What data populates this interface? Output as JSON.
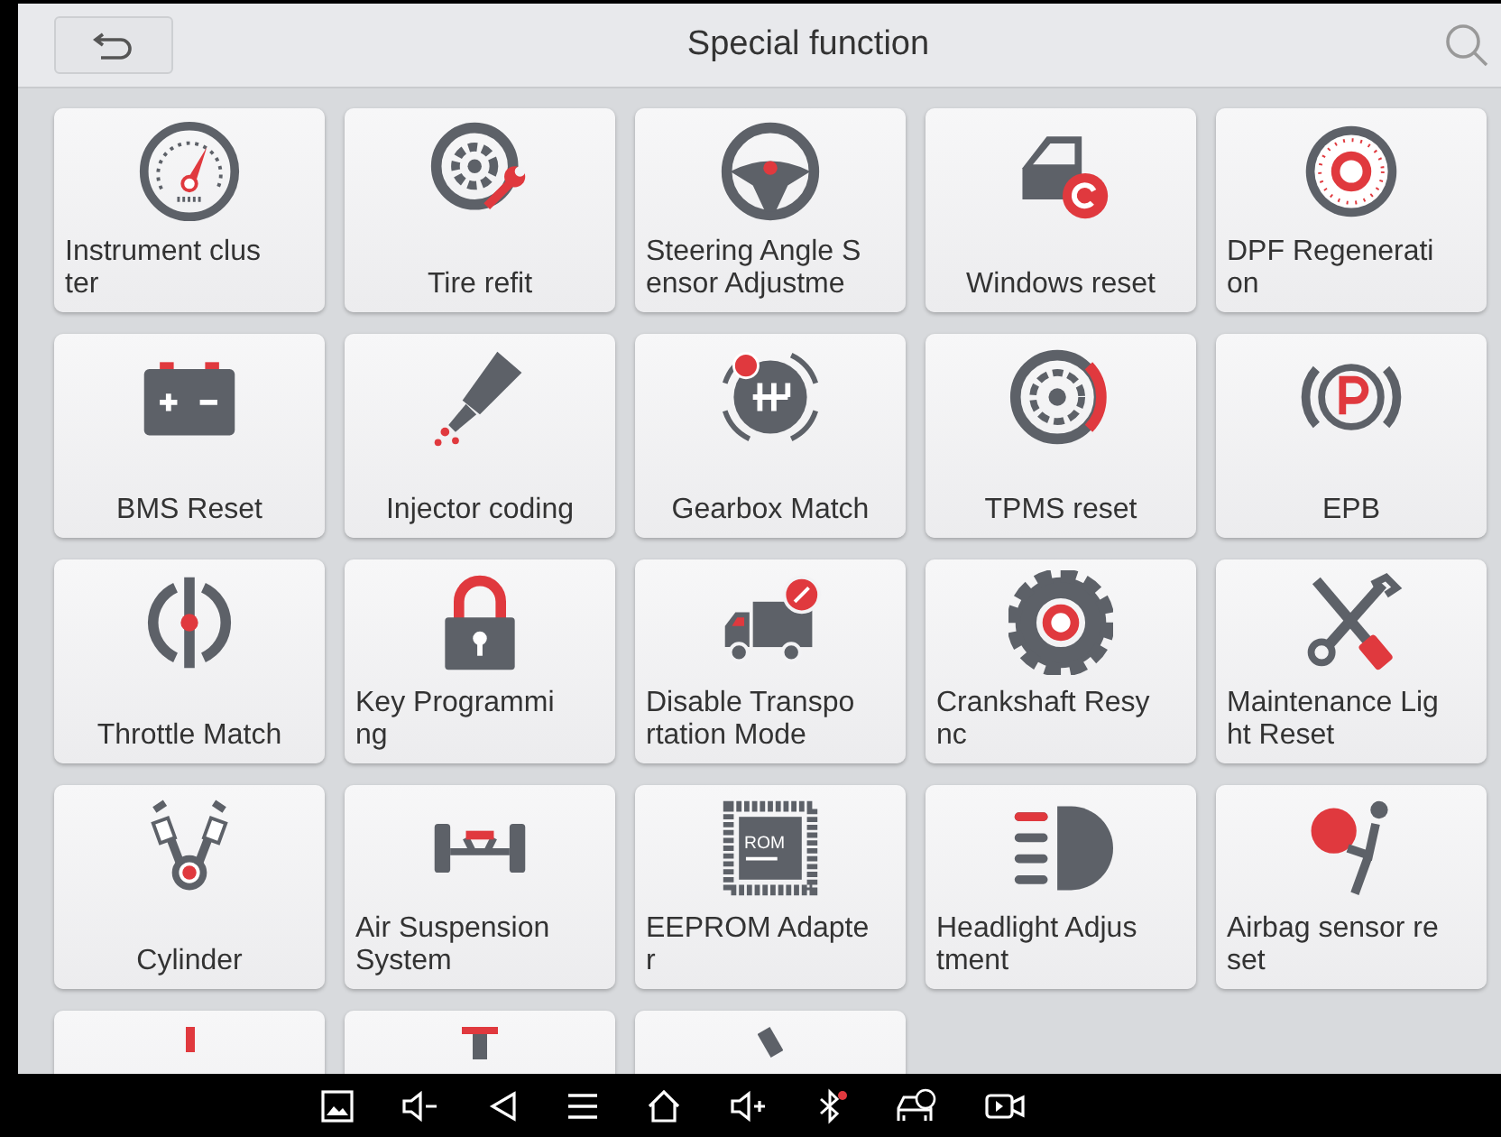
{
  "header": {
    "title": "Special function"
  },
  "tiles": [
    {
      "kind": "full",
      "lines": [
        "Instrument clus",
        "ter"
      ]
    },
    {
      "kind": "full",
      "lines": [
        "Tire refit"
      ]
    },
    {
      "kind": "full",
      "lines": [
        "Steering Angle S",
        "ensor Adjustme"
      ]
    },
    {
      "kind": "full",
      "lines": [
        "Windows reset"
      ]
    },
    {
      "kind": "full",
      "lines": [
        "DPF Regenerati",
        "on"
      ]
    },
    {
      "kind": "full",
      "lines": [
        "BMS Reset"
      ]
    },
    {
      "kind": "full",
      "lines": [
        "Injector coding"
      ]
    },
    {
      "kind": "full",
      "lines": [
        "Gearbox Match"
      ]
    },
    {
      "kind": "full",
      "lines": [
        "TPMS reset"
      ]
    },
    {
      "kind": "full",
      "lines": [
        "EPB"
      ]
    },
    {
      "kind": "full",
      "lines": [
        "Throttle Match"
      ]
    },
    {
      "kind": "full",
      "lines": [
        "Key Programmi",
        "ng"
      ]
    },
    {
      "kind": "full",
      "lines": [
        "Disable Transpo",
        "rtation Mode"
      ]
    },
    {
      "kind": "full",
      "lines": [
        "Crankshaft Resy",
        "nc"
      ]
    },
    {
      "kind": "full",
      "lines": [
        "Maintenance Lig",
        "ht Reset"
      ]
    },
    {
      "kind": "full",
      "lines": [
        "Cylinder"
      ]
    },
    {
      "kind": "full",
      "lines": [
        "Air Suspension",
        "System"
      ]
    },
    {
      "kind": "full",
      "lines": [
        "EEPROM Adapte",
        "r"
      ],
      "icon_text": "ROM"
    },
    {
      "kind": "full",
      "lines": [
        "Headlight Adjus",
        "tment"
      ]
    },
    {
      "kind": "full",
      "lines": [
        "Airbag sensor re",
        "set"
      ]
    },
    {
      "kind": "partial"
    },
    {
      "kind": "partial"
    },
    {
      "kind": "partial"
    }
  ],
  "nav_bar": {
    "bluetooth_alert": true
  }
}
